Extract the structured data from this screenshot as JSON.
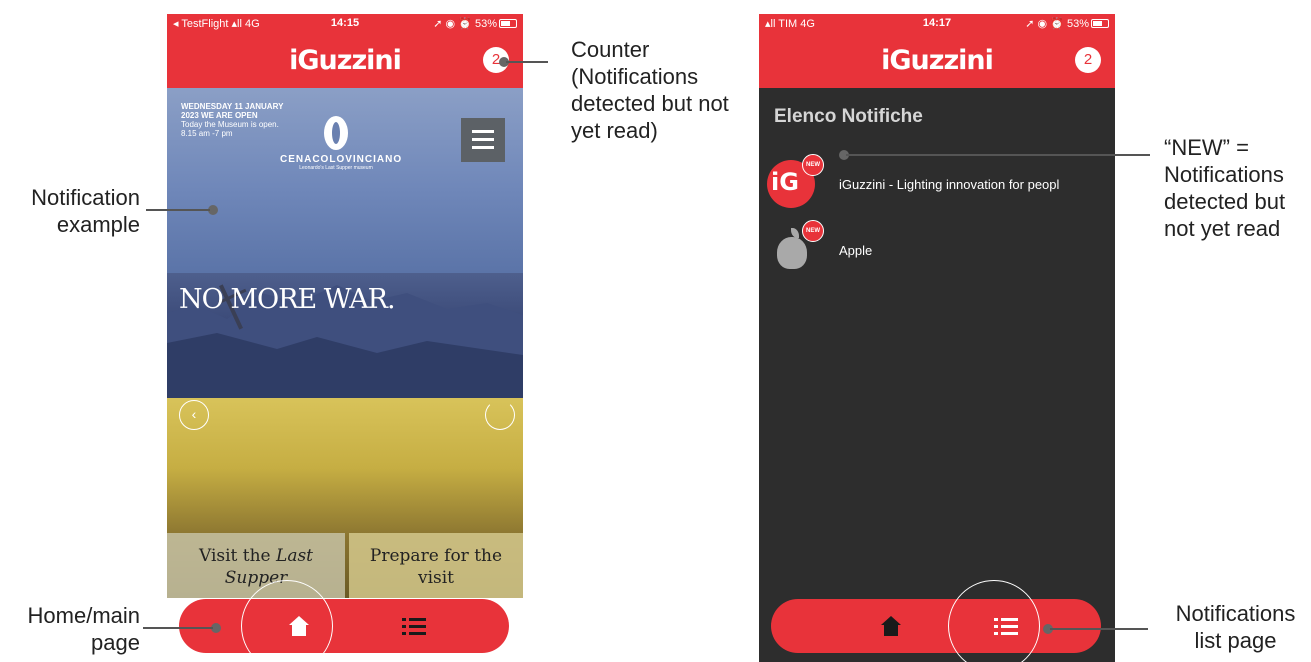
{
  "annotations": {
    "counter_label": "Counter (Notifications detected but not yet read)",
    "notification_example_label": "Notification example",
    "home_label": "Home/main page",
    "new_label": "“NEW” = Notifications detected but not yet read",
    "list_label": "Notifications list page"
  },
  "phone_left": {
    "status": {
      "left": "◂ TestFlight ▴ll 4G",
      "time": "14:15",
      "right": "➚ ◉ ⏰ 53%"
    },
    "header": {
      "logo": "iGuzzini",
      "counter": "2"
    },
    "museum_page": {
      "date": "WEDNESDAY 11 JANUARY 2023 WE ARE OPEN",
      "hours": "Today the Museum is open. 8.15 am -7 pm",
      "logo_name": "CENACOLOVINCIANO",
      "logo_sub": "Leonardo's Last Supper museum",
      "headline": "NO MORE WAR.",
      "cards": [
        {
          "line1": "Visit the ",
          "italic1": "Last",
          "italic2": "Supper"
        },
        {
          "line1": "Prepare for the",
          "line2": "visit"
        }
      ]
    }
  },
  "phone_right": {
    "status": {
      "left": "▴ll TIM 4G",
      "time": "14:17",
      "right": "➚ ◉ ⏰ 53%"
    },
    "header": {
      "logo": "iGuzzini",
      "counter": "2"
    },
    "list": {
      "title": "Elenco Notifiche",
      "items": [
        {
          "title": "iGuzzini - Lighting innovation for peopl",
          "badge": "NEW",
          "avatar_text": "iG",
          "icon": "iguzzini-logo-icon"
        },
        {
          "title": "Apple",
          "badge": "NEW",
          "icon": "apple-logo-icon"
        }
      ]
    }
  },
  "colors": {
    "brand_red": "#e8333a",
    "list_background": "#2d2d2d"
  }
}
